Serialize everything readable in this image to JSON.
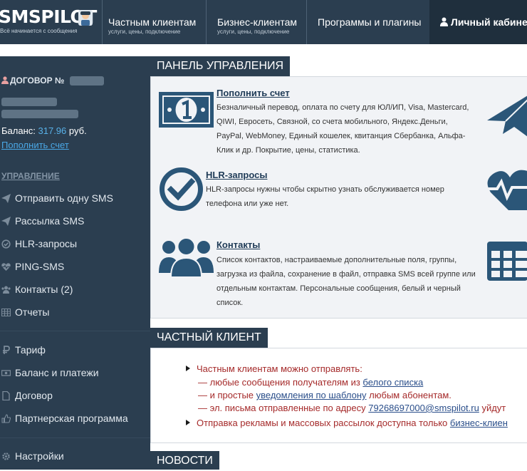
{
  "topnav": {
    "logo_text": "SMSPILOT",
    "logo_sub": "Всё начинается с сообщения",
    "items": [
      {
        "title": "Частным клиентам",
        "sub": "услуги, цены, подключение"
      },
      {
        "title": "Бизнес-клиентам",
        "sub": "услуги, цены, подключение"
      },
      {
        "title": "Программы и плагины",
        "sub": ""
      }
    ],
    "cabinet": "Личный кабинет"
  },
  "sidebar": {
    "contract_label": "ДОГОВОР №",
    "balance_label": "Баланс:",
    "balance_value": "317.96",
    "balance_currency": "руб.",
    "topup_link": "Пополнить счет",
    "section_heading": "УПРАВЛЕНИЕ",
    "items": [
      {
        "icon": "send-icon",
        "label": "Отправить одну SMS"
      },
      {
        "icon": "broadcast-icon",
        "label": "Рассылка SMS"
      },
      {
        "icon": "check-circle-icon",
        "label": "HLR-запросы"
      },
      {
        "icon": "heartbeat-icon",
        "label": "PING-SMS"
      },
      {
        "icon": "users-icon",
        "label": "Контакты (2)"
      },
      {
        "icon": "table-icon",
        "label": "Отчеты"
      },
      {
        "icon": "ruble-icon",
        "label": "Тариф"
      },
      {
        "icon": "money-icon",
        "label": "Баланс и платежи"
      },
      {
        "icon": "document-icon",
        "label": "Договор"
      },
      {
        "icon": "thumbs-up-icon",
        "label": "Партнерская программа"
      },
      {
        "icon": "gear-icon",
        "label": "Настройки"
      }
    ]
  },
  "panel": {
    "title": "ПАНЕЛЬ УПРАВЛЕНИЯ",
    "features": [
      {
        "icon": "banknote-icon",
        "link": "Пополнить счет",
        "desc": "Безналичный перевод, оплата по счету для ЮЛ/ИП, Visa, Mastercard, QIWI, Евросеть, Связной, со счета мобильного, Яндекс.Деньги, PayPal, WebMoney, Единый кошелек, квитанция Сбербанка, Альфа-Клик и др. Покрытие, цены, статистика."
      },
      {
        "icon": "check-circle-icon",
        "link": "HLR-запросы",
        "desc": "HLR-запросы нужны чтобы скрытно узнать обслуживается номер телефона или уже нет."
      },
      {
        "icon": "users-icon",
        "link": "Контакты",
        "desc": "Список контактов, настраиваемые дополнительные поля, группы, загрузка из файла, сохранение в файл, отправка SMS всей группе или отдельным контактам. Персональные сообщения, белый и черный список."
      }
    ],
    "right_icons": [
      "paper-plane-icon",
      "heartbeat-icon",
      "table-icon"
    ]
  },
  "private": {
    "title": "ЧАСТНЫЙ КЛИЕНТ",
    "line1": "Частным клиентам можно отправлять:",
    "line2_pre": "— любые сообщения получателям из ",
    "line2_link": "белого списка",
    "line3_pre": "— и простые ",
    "line3_link": "уведомления по шаблону",
    "line3_post": " любым абонентам.",
    "line4_pre": "— эл. письма отправленные по адресу ",
    "line4_link": "79268697000@smspilot.ru",
    "line4_post": " уйдут",
    "line5_pre": "Отправка рекламы и массовых рассылок доступна только ",
    "line5_link": "бизнес-клиен"
  },
  "news": {
    "title": "НОВОСТИ"
  },
  "colors": {
    "nav_bg": "#2b3e50",
    "accent_link": "#4aa8e6",
    "balance_value": "#58b1e8",
    "private_text": "#a52a2a",
    "icon_blue": "#2b5678"
  }
}
